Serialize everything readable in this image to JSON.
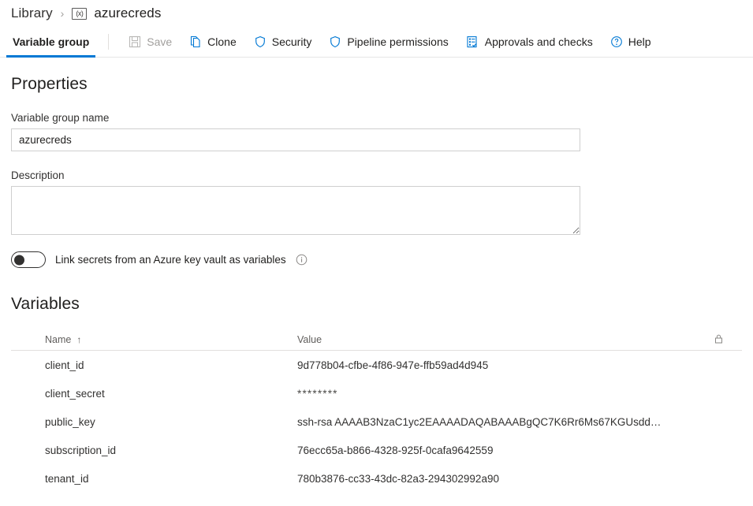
{
  "breadcrumb": {
    "root_label": "Library",
    "separator": "›",
    "icon_glyph": "(x)",
    "current_label": "azurecreds"
  },
  "toolbar": {
    "active_tab": "Variable group",
    "save_label": "Save",
    "clone_label": "Clone",
    "security_label": "Security",
    "pipeline_permissions_label": "Pipeline permissions",
    "approvals_label": "Approvals and checks",
    "help_label": "Help",
    "accent_color": "#0078d4",
    "disabled_color": "#a19f9d"
  },
  "properties": {
    "heading": "Properties",
    "name_label": "Variable group name",
    "name_value": "azurecreds",
    "name_placeholder": "",
    "description_label": "Description",
    "description_value": "",
    "description_placeholder": "",
    "keyvault_toggle_label": "Link secrets from an Azure key vault as variables",
    "keyvault_toggle_state": "off"
  },
  "variables": {
    "heading": "Variables",
    "columns": {
      "name": "Name",
      "sort_indicator": "↑",
      "value": "Value",
      "lock": "lock-icon"
    },
    "rows": [
      {
        "name": "client_id",
        "value": "9d778b04-cfbe-4f86-947e-ffb59ad4d945",
        "masked": false
      },
      {
        "name": "client_secret",
        "value": "********",
        "masked": true
      },
      {
        "name": "public_key",
        "value": "ssh-rsa AAAAB3NzaC1yc2EAAAADAQABAAABgQC7K6Rr6Ms67KGUsdd…",
        "masked": false
      },
      {
        "name": "subscription_id",
        "value": "76ecc65a-b866-4328-925f-0cafa9642559",
        "masked": false
      },
      {
        "name": "tenant_id",
        "value": "780b3876-cc33-43dc-82a3-294302992a90",
        "masked": false
      }
    ]
  }
}
